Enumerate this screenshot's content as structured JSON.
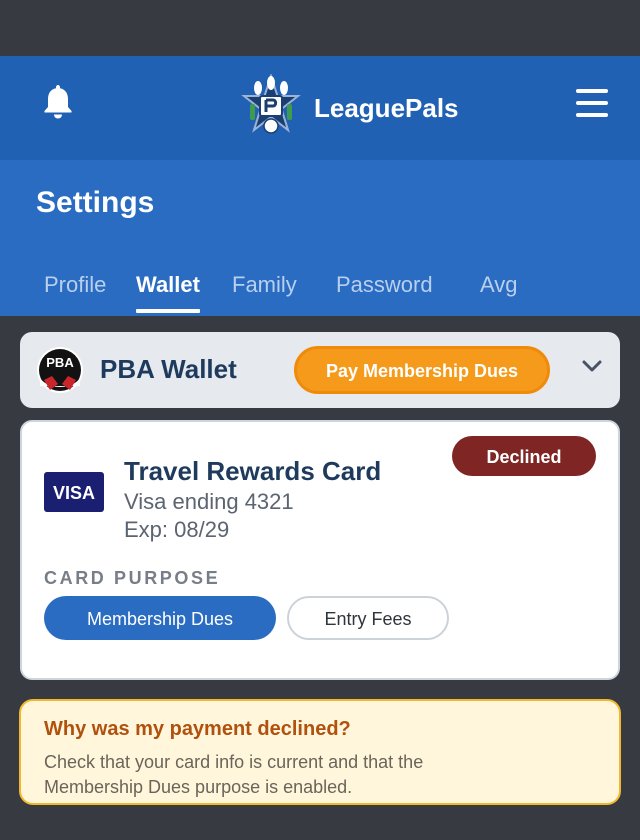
{
  "header": {
    "brand": "LeaguePals",
    "icons": {
      "notifications": "bell-icon",
      "logo": "leaguepals-star-logo",
      "menu": "hamburger-menu-icon"
    },
    "colors": {
      "header_bg": "#2161b3",
      "panel_bg": "#2a6cc2"
    }
  },
  "settings": {
    "title": "Settings",
    "tabs": [
      {
        "label": "Profile",
        "active": false
      },
      {
        "label": "Wallet",
        "active": true
      },
      {
        "label": "Family",
        "active": false
      },
      {
        "label": "Password",
        "active": false
      },
      {
        "label": "Avg",
        "active": false
      }
    ]
  },
  "wallet": {
    "logo_text": "PBA",
    "title": "PBA Wallet",
    "pay_button": "Pay Membership Dues",
    "expand_icon": "chevron-down-icon",
    "colors": {
      "pay_button": "#f59a1b"
    }
  },
  "card": {
    "status": "Declined",
    "brand_label": "VISA",
    "name": "Travel Rewards Card",
    "ending": "Visa ending 4321",
    "expiry": "Exp: 08/29",
    "purpose_label": "CARD PURPOSE",
    "purposes": [
      {
        "label": "Membership Dues",
        "selected": true
      },
      {
        "label": "Entry Fees",
        "selected": false
      }
    ],
    "colors": {
      "declined": "#7f2625",
      "selected_purpose": "#2a6cc2",
      "visa": "#1a1f71"
    }
  },
  "help": {
    "title": "Why was my payment declined?",
    "body": "Check that your card info is current and that the Membership Dues purpose is enabled.",
    "colors": {
      "background": "#fff6dc",
      "border": "#f0b82c",
      "title": "#b0510e"
    }
  }
}
